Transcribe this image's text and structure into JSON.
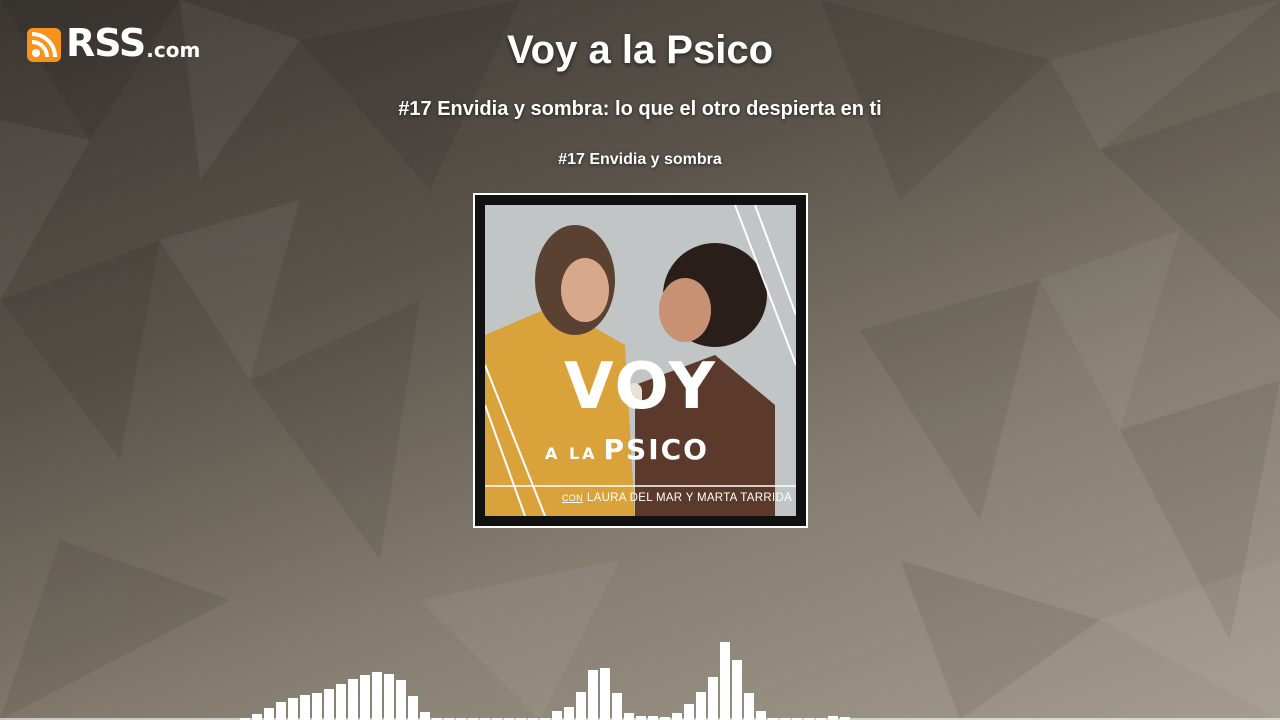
{
  "brand": {
    "logo_main": "RSS",
    "logo_suffix": ".com",
    "icon": "rss-feed-icon",
    "icon_color": "#f7931a"
  },
  "podcast": {
    "title": "Voy a la Psico",
    "episode_full_title": "#17 Envidia y sombra: lo que el otro despierta en ti",
    "episode_short_title": "#17 Envidia y sombra"
  },
  "cover": {
    "word_voy": "VOY",
    "word_a_la": "A LA",
    "word_psico": "PSICO",
    "credit_con": "CON",
    "credit_names": "LAURA DEL MAR Y MARTA TARRIDA"
  },
  "colors": {
    "text": "#ffffff",
    "waveform": "#ffffff",
    "cover_frame": "#ffffff"
  }
}
